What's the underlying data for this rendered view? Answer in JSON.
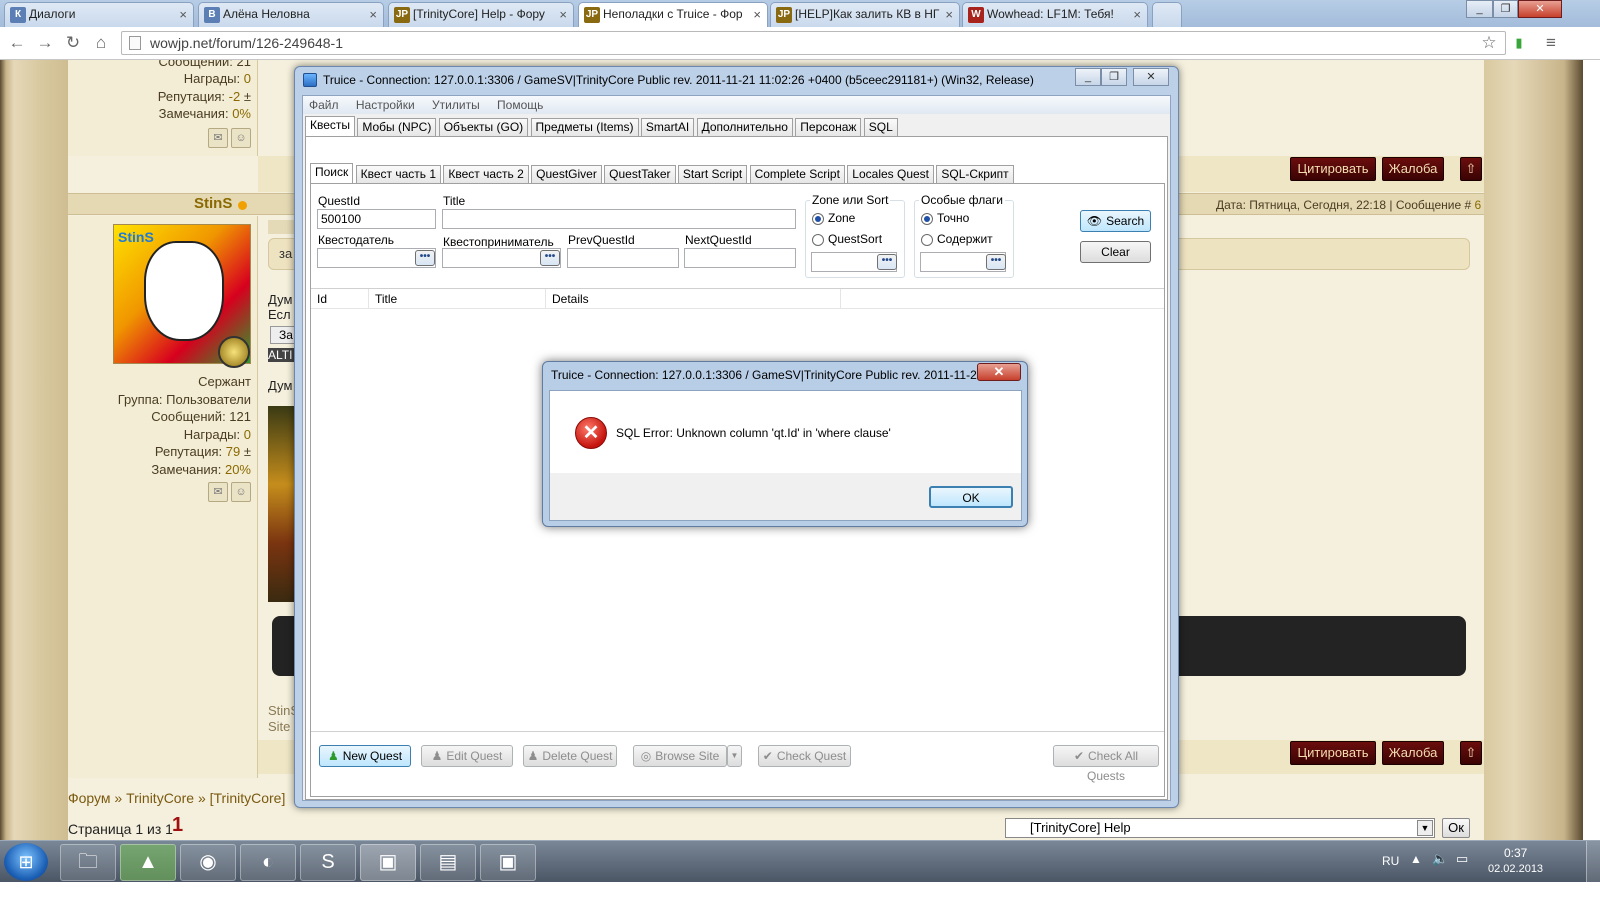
{
  "browser": {
    "tabs": [
      {
        "label": "Диалоги",
        "fav": "К",
        "color": "#5b7fb5"
      },
      {
        "label": "Алёна Неловна",
        "fav": "В",
        "color": "#5b7fb5"
      },
      {
        "label": "[TrinityCore] Help - Фору",
        "fav": "JP",
        "color": "#8a6a10"
      },
      {
        "label": "Неполадки с Truice - Фор",
        "fav": "JP",
        "color": "#8a6a10"
      },
      {
        "label": "[HELP]Как залить КВ в НГ",
        "fav": "JP",
        "color": "#8a6a10"
      },
      {
        "label": "Wowhead: LF1M: Тебя!",
        "fav": "W",
        "color": "#a8231b"
      }
    ],
    "url": "wowjp.net/forum/126-249648-1"
  },
  "forum": {
    "prev_post": {
      "messages": "Сообщений: 21",
      "awards_label": "Награды:",
      "awards": "0",
      "rep_label": "Репутация:",
      "rep": "-2",
      "rep_pm": "±",
      "warn_label": "Замечания:",
      "warn": "0%"
    },
    "author": "StinS",
    "post_date": "Дата: Пятница, Сегодня, 22:18 | Сообщение #",
    "post_no": "6",
    "rank": "Сержант",
    "group": "Группа: Пользователи",
    "messages": "Сообщений: 121",
    "awards_label": "Награды:",
    "awards": "0",
    "rep_label": "Репутация:",
    "rep": "79",
    "rep_pm": "±",
    "warn_label": "Замечания:",
    "warn": "20%",
    "quote_label": "Цитировать",
    "report_label": "Жалоба",
    "body_fragments": [
      "за",
      "Дум",
      "Есл",
      "За",
      "ALTI",
      "Дум",
      "StinS",
      "Site"
    ],
    "breadcrumb": [
      "Форум",
      "»",
      "TrinityCore",
      "»",
      "[TrinityCore] "
    ],
    "page_label": "Страница 1 из 1",
    "page_num": "1",
    "jump_value": "[TrinityCore] Help",
    "jump_ok": "Ок",
    "avatar_text": "StinS"
  },
  "truice": {
    "title": "Truice - Connection: 127.0.0.1:3306 / GameSV|TrinityCore Public rev. 2011-11-21 11:02:26 +0400 (b5ceec291181+) (Win32, Release)",
    "menu": [
      "Файл",
      "Настройки",
      "Утилиты",
      "Помощь"
    ],
    "main_tabs": [
      "Квесты",
      "Мобы (NPC)",
      "Объекты (GO)",
      "Предметы (Items)",
      "SmartAI",
      "Дополнительно",
      "Персонаж",
      "SQL"
    ],
    "sub_tabs": [
      "Поиск",
      "Квест часть 1",
      "Квест часть 2",
      "QuestGiver",
      "QuestTaker",
      "Start Script",
      "Complete Script",
      "Locales Quest",
      "SQL-Скрипт"
    ],
    "fields": {
      "questid_label": "QuestId",
      "questid_value": "500100",
      "title_label": "Title",
      "giver_label": "Квестодатель",
      "taker_label": "Квестоприниматель",
      "prev_label": "PrevQuestId",
      "next_label": "NextQuestId"
    },
    "zone_group": {
      "title": "Zone или Sort",
      "opt1": "Zone",
      "opt2": "QuestSort"
    },
    "flags_group": {
      "title": "Особые флаги",
      "opt1": "Точно",
      "opt2": "Содержит"
    },
    "search_btn": "Search",
    "clear_btn": "Clear",
    "columns": [
      "Id",
      "Title",
      "Details"
    ],
    "buttons": {
      "new": "New Quest",
      "edit": "Edit Quest",
      "delete": "Delete Quest",
      "browse": "Browse Site",
      "check": "Check Quest",
      "check_all": "Check All Quests"
    }
  },
  "dialog": {
    "title": "Truice - Connection: 127.0.0.1:3306 / GameSV|TrinityCore Public rev. 2011-11-2...",
    "message": "SQL Error: Unknown column 'qt.Id' in 'where clause'",
    "ok": "OK"
  },
  "taskbar": {
    "lang": "RU",
    "time": "0:37",
    "date": "02.02.2013"
  }
}
